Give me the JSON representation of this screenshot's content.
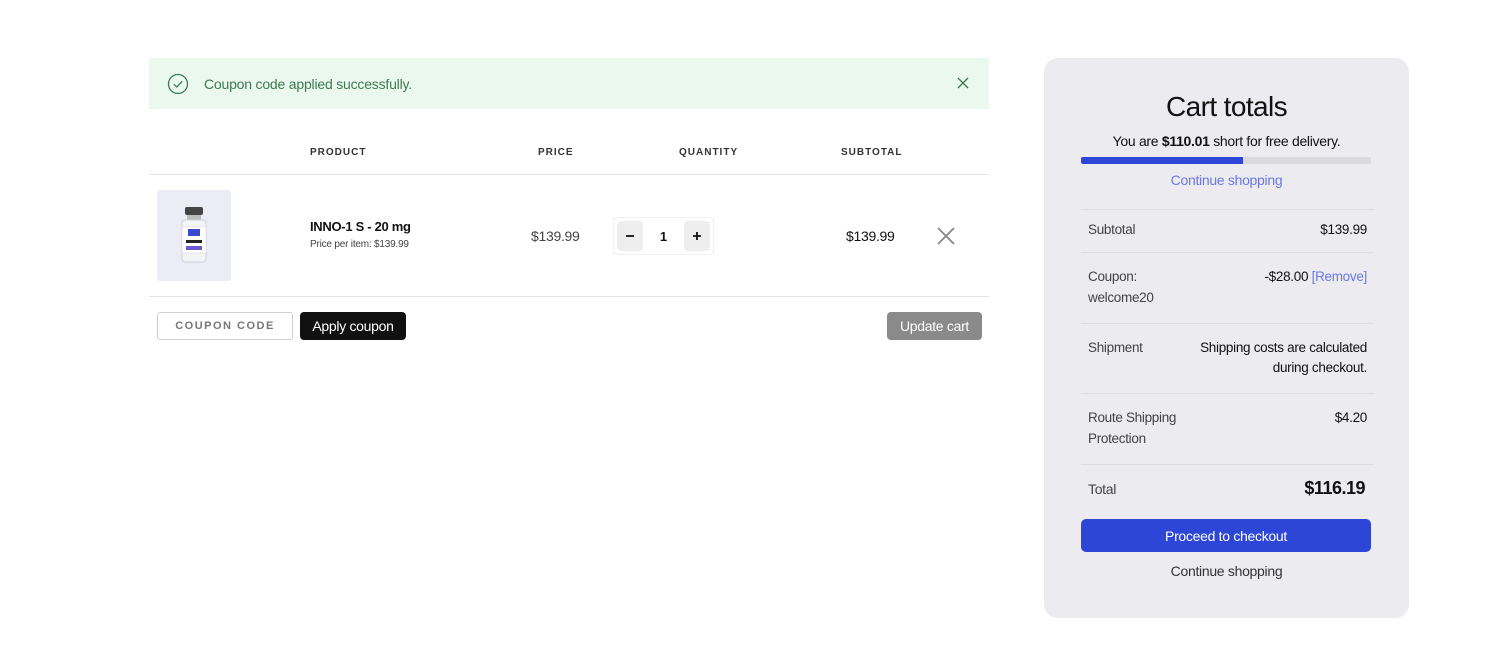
{
  "notice": {
    "message": "Coupon code applied successfully.",
    "success_color": "#3f7a52"
  },
  "cart": {
    "columns": [
      "PRODUCT",
      "PRICE",
      "QUANTITY",
      "SUBTOTAL"
    ],
    "items": [
      {
        "name": "INNO-1 S - 20 mg",
        "price_per_item": "Price per item: $139.99",
        "price": "$139.99",
        "quantity": "1",
        "subtotal": "$139.99"
      }
    ],
    "coupon_placeholder": "COUPON CODE",
    "apply_label": "Apply coupon",
    "update_label": "Update cart"
  },
  "totals": {
    "title": "Cart totals",
    "free_delivery_prefix": "You are",
    "free_delivery_amount": "$110.01",
    "free_delivery_suffix": "short for free delivery.",
    "progress_fraction": 0.56,
    "continue_link": "Continue shopping",
    "subtotal_label": "Subtotal",
    "subtotal_value": "$139.99",
    "coupon_label_line1": "Coupon:",
    "coupon_label_line2": "welcome20",
    "coupon_value": "-$28.00",
    "coupon_remove": "[Remove]",
    "shipment_label": "Shipment",
    "shipment_line1": "Shipping costs are calculated",
    "shipment_line2": "during checkout.",
    "route_label_line1": "Route Shipping",
    "route_label_line2": "Protection",
    "route_value": "$4.20",
    "total_label": "Total",
    "total_value": "$116.19",
    "checkout_label": "Proceed to checkout",
    "continue_label": "Continue shopping",
    "accent_color": "#2d46d8"
  }
}
